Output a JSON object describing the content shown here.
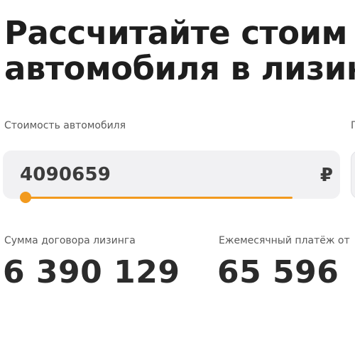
{
  "heading": {
    "line1": "Рассчитайте стоим",
    "line2": "автомобиля в лизин"
  },
  "car_cost": {
    "label": "Стоимость автомобиля",
    "value": "4090659",
    "currency": "₽",
    "slider_fraction": 0.0
  },
  "next_field": {
    "label": "П"
  },
  "results": {
    "contract_sum_label": "Сумма договора лизинга",
    "contract_sum_value": "6 390 129",
    "monthly_payment_label": "Ежемесячный платёж от",
    "monthly_payment_value": "65 596"
  },
  "colors": {
    "accent": "#f29a1e",
    "field_bg": "#f1f1f3",
    "text": "#1e1e1e"
  }
}
